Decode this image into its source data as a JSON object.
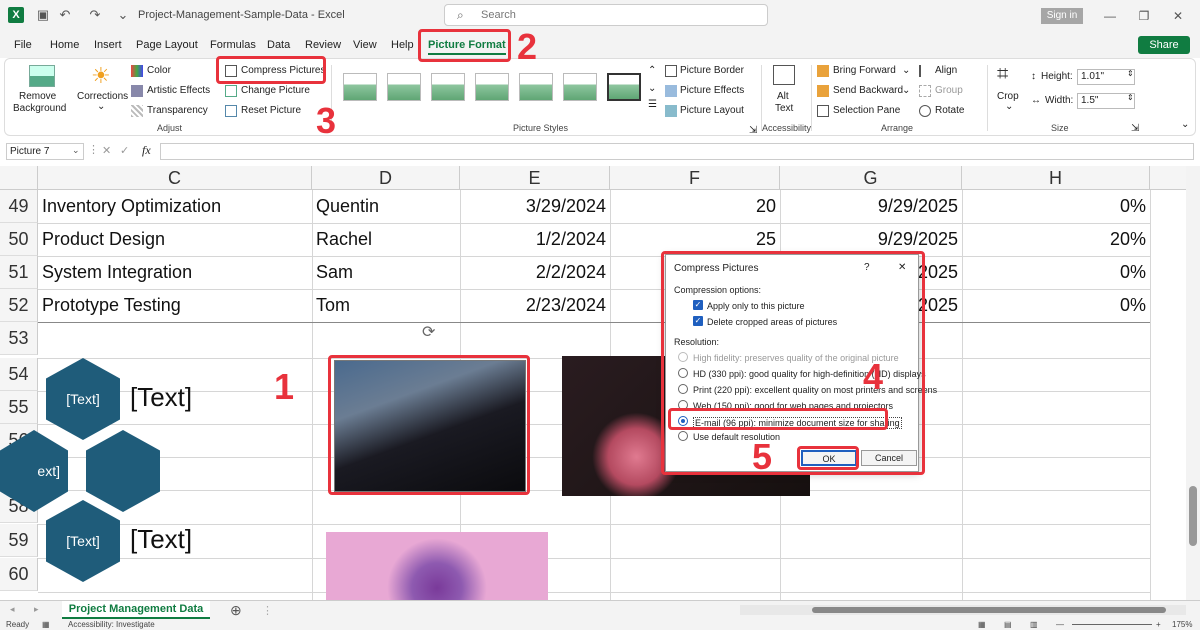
{
  "titlebar": {
    "logo": "X",
    "title": "Project-Management-Sample-Data  -  Excel",
    "search_placeholder": "Search",
    "signin": "Sign in"
  },
  "menu": [
    "File",
    "Home",
    "Insert",
    "Page Layout",
    "Formulas",
    "Data",
    "Review",
    "View",
    "Help",
    "Picture Format"
  ],
  "share": "Share",
  "ribbon": {
    "remove_bg": [
      "Remove",
      "Background"
    ],
    "corrections": "Corrections",
    "color": "Color",
    "artistic": "Artistic Effects",
    "transparency": "Transparency",
    "compress": "Compress Pictures",
    "change": "Change Picture",
    "reset": "Reset Picture",
    "adjust_label": "Adjust",
    "styles_label": "Picture Styles",
    "border": "Picture Border",
    "effects": "Picture Effects",
    "layout": "Picture Layout",
    "alt": [
      "Alt",
      "Text"
    ],
    "accessibility_label": "Accessibility",
    "bring_forward": "Bring Forward",
    "send_backward": "Send Backward",
    "selection_pane": "Selection Pane",
    "align": "Align",
    "group": "Group",
    "rotate": "Rotate",
    "arrange_label": "Arrange",
    "crop": "Crop",
    "height_label": "Height:",
    "height": "1.01\"",
    "width_label": "Width:",
    "width": "1.5\"",
    "size_label": "Size"
  },
  "formula": {
    "namebox": "Picture 7",
    "fx": "fx"
  },
  "columns": [
    "C",
    "D",
    "E",
    "F",
    "G",
    "H"
  ],
  "rows": [
    {
      "num": "49",
      "c": "Inventory Optimization",
      "d": "Quentin",
      "e": "3/29/2024",
      "f": "20",
      "g": "9/29/2025",
      "h": "0%"
    },
    {
      "num": "50",
      "c": "Product Design",
      "d": "Rachel",
      "e": "1/2/2024",
      "f": "25",
      "g": "9/29/2025",
      "h": "20%"
    },
    {
      "num": "51",
      "c": "System Integration",
      "d": "Sam",
      "e": "2/2/2024",
      "f": "30",
      "g": "2025",
      "h": "0%"
    },
    {
      "num": "52",
      "c": "Prototype Testing",
      "d": "Tom",
      "e": "2/23/2024",
      "f": "",
      "g": "2025",
      "h": "0%"
    },
    {
      "num": "53"
    },
    {
      "num": "54"
    },
    {
      "num": "55"
    },
    {
      "num": "56"
    },
    {
      "num": "57"
    },
    {
      "num": "58"
    },
    {
      "num": "59"
    },
    {
      "num": "60"
    }
  ],
  "smartart": {
    "hex1": "[Text]",
    "hex2": "ext]",
    "hex3": "[Text]",
    "label1": "[Text]",
    "label2": "[Text]"
  },
  "dialog": {
    "title": "Compress Pictures",
    "help": "?",
    "close": "✕",
    "compression_options": "Compression options:",
    "apply_only": "Apply only to this picture",
    "delete_cropped": "Delete cropped areas of pictures",
    "resolution": "Resolution:",
    "options": [
      "High fidelity: preserves quality of the original picture",
      "HD (330 ppi): good quality for high-definition (HD) displays",
      "Print (220 ppi): excellent quality on most printers and screens",
      "Web (150 ppi): good for web pages and projectors",
      "E-mail (96 ppi): minimize document size for sharing",
      "Use default resolution"
    ],
    "ok": "OK",
    "cancel": "Cancel"
  },
  "steps": [
    "1",
    "2",
    "3",
    "4",
    "5"
  ],
  "sheet_tab": "Project Management Data",
  "status": {
    "ready": "Ready",
    "accessibility": "Accessibility: Investigate",
    "zoom": "175%"
  },
  "colors": {
    "accent": "#107c41",
    "annotation": "#e8323c",
    "hex": "#1f5c7a"
  }
}
